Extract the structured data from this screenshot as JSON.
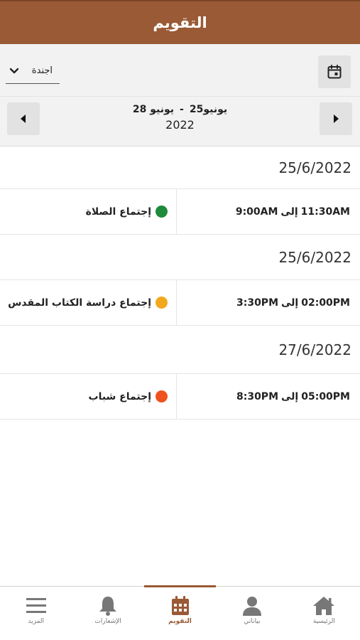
{
  "header": {
    "title": "التقويم"
  },
  "toolbar": {
    "view_select": {
      "value": "اجندة"
    }
  },
  "range": {
    "start": "يونيو25",
    "separator": "-",
    "end": "يونيو 28",
    "year": "2022"
  },
  "agenda": {
    "groups": [
      {
        "date": "25/6/2022",
        "events": [
          {
            "title": "إجتماع الصلاة",
            "color": "#1f8a3c",
            "start": "11:30AM",
            "to": "إلى",
            "end": "9:00AM"
          }
        ]
      },
      {
        "date": "25/6/2022",
        "events": [
          {
            "title": "إجتماع دراسة الكتاب المقدس",
            "color": "#f2a81d",
            "start": "02:00PM",
            "to": "إلى",
            "end": "3:30PM"
          }
        ]
      },
      {
        "date": "27/6/2022",
        "events": [
          {
            "title": "إجتماع شباب",
            "color": "#f0521f",
            "start": "05:00PM",
            "to": "إلى",
            "end": "8:30PM"
          }
        ]
      }
    ]
  },
  "bottom_nav": {
    "items": [
      {
        "label": "المزيد",
        "icon": "menu-icon"
      },
      {
        "label": "الإشعارات",
        "icon": "bell-icon"
      },
      {
        "label": "التقويم",
        "icon": "calendar-icon",
        "active": true
      },
      {
        "label": "بياناتي",
        "icon": "user-icon"
      },
      {
        "label": "الرئيسية",
        "icon": "home-icon"
      }
    ]
  },
  "colors": {
    "brand": "#9a5a35",
    "inactive_icon": "#777777"
  }
}
